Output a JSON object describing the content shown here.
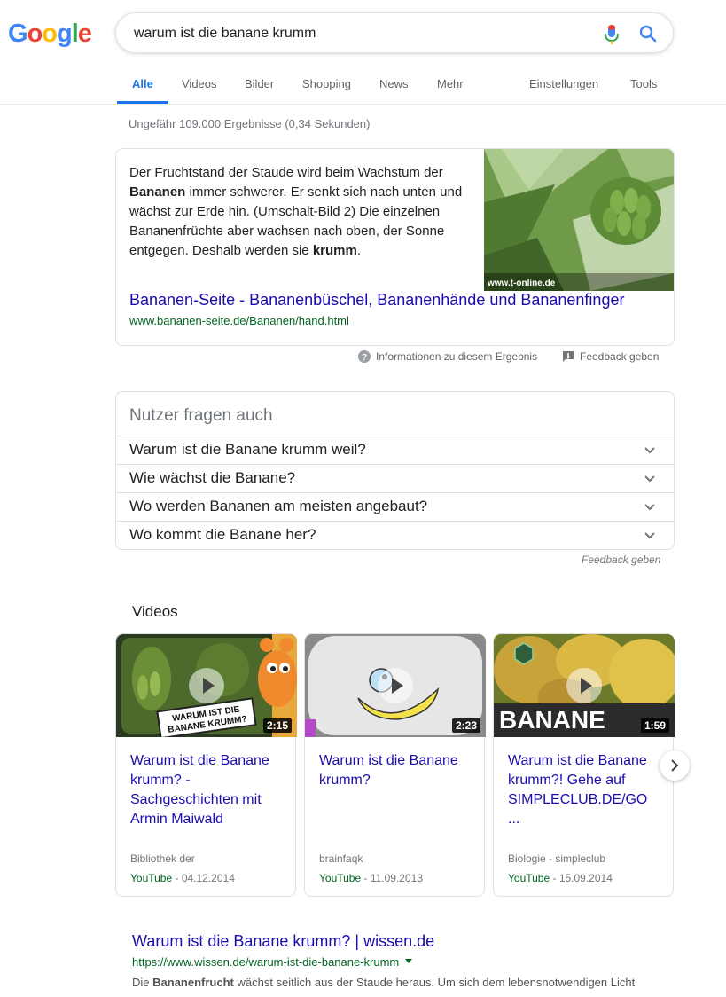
{
  "logo": {
    "letters": [
      "G",
      "o",
      "o",
      "g",
      "l",
      "e"
    ],
    "colors": [
      "#4285f4",
      "#ea4335",
      "#fbbc05",
      "#4285f4",
      "#34a853",
      "#ea4335"
    ]
  },
  "search": {
    "query": "warum ist die banane krumm"
  },
  "tabs": [
    {
      "label": "Alle",
      "active": true
    },
    {
      "label": "Videos"
    },
    {
      "label": "Bilder"
    },
    {
      "label": "Shopping"
    },
    {
      "label": "News"
    },
    {
      "label": "Mehr"
    },
    {
      "label": "Einstellungen"
    },
    {
      "label": "Tools"
    }
  ],
  "stats": "Ungefähr 109.000 Ergebnisse (0,34 Sekunden)",
  "snippet": {
    "text_parts": [
      "Der Fruchtstand der Staude wird beim Wachstum der ",
      "Bananen",
      " immer schwerer. Er senkt sich nach unten und wächst zur Erde hin. (Umschalt-Bild 2) Die einzelnen Bananenfrüchte aber wachsen nach oben, der Sonne entgegen. Deshalb werden sie ",
      "krumm",
      "."
    ],
    "image_caption": "www.t-online.de",
    "link": "Bananen-Seite - Bananenbüschel, Bananenhände und Bananenfinger",
    "url": "www.bananen-seite.de/Bananen/hand.html",
    "info_label": "Informationen zu diesem Ergebnis",
    "feedback_label": "Feedback geben"
  },
  "paa": {
    "title": "Nutzer fragen auch",
    "questions": [
      "Warum ist die Banane krumm weil?",
      "Wie wächst die Banane?",
      "Wo werden Bananen am meisten angebaut?",
      "Wo kommt die Banane her?"
    ],
    "feedback": "Feedback geben"
  },
  "videos": {
    "title": "Videos",
    "items": [
      {
        "title": "Warum ist die Banane krumm? - Sachgeschichten mit Armin Maiwald",
        "duration": "2:15",
        "source": "Bibliothek der",
        "site": "YouTube",
        "date": " - 04.12.2014",
        "overlay": "WARUM IST DIE BANANE KRUMM?"
      },
      {
        "title": "Warum ist die Banane krumm?",
        "duration": "2:23",
        "source": "brainfaqk",
        "site": "YouTube",
        "date": " - 11.09.2013"
      },
      {
        "title": "Warum ist die Banane krumm?! Gehe auf SIMPLECLUB.DE/GO ...",
        "duration": "1:59",
        "source": "Biologie - simpleclub",
        "site": "YouTube",
        "date": " - 15.09.2014",
        "overlay": "BANANE"
      }
    ]
  },
  "result": {
    "title": "Warum ist die Banane krumm? | wissen.de",
    "url": "https://www.wissen.de/warum-ist-die-banane-krumm",
    "snippet_parts": [
      "Die ",
      "Bananenfrucht",
      " wächst seitlich aus der Staude heraus. Um sich dem lebensnotwendigen Licht"
    ]
  }
}
